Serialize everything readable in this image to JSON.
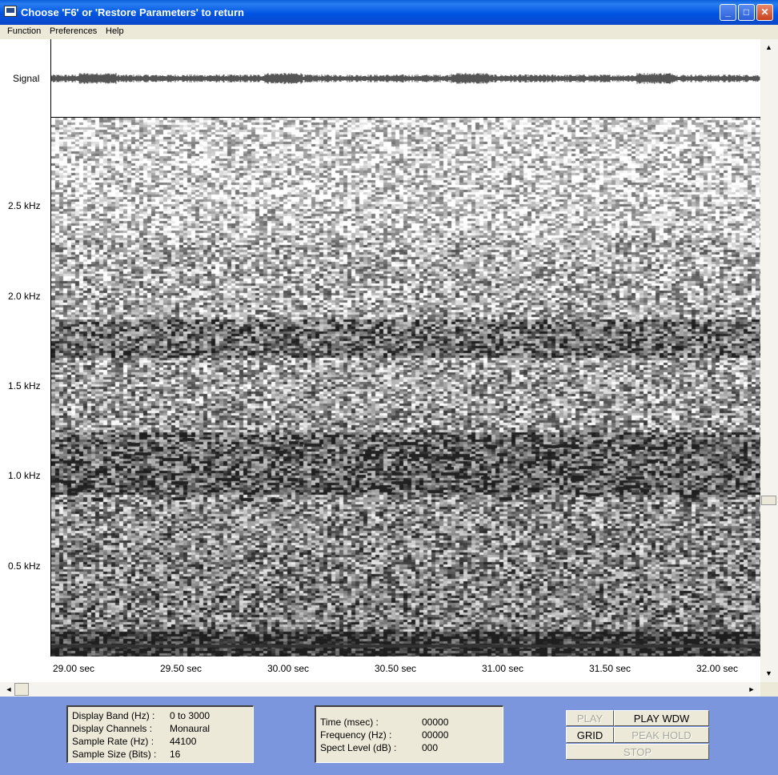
{
  "window": {
    "title": "Choose 'F6' or 'Restore Parameters' to return"
  },
  "title_buttons": {
    "minimize": "_",
    "maximize": "□",
    "close": "✕"
  },
  "menu": [
    "Function",
    "Preferences",
    "Help"
  ],
  "plot": {
    "signal_label": "Signal",
    "y_labels": [
      "2.5 kHz",
      "2.0 kHz",
      "1.5 kHz",
      "1.0 kHz",
      "0.5 kHz"
    ],
    "x_labels": [
      "29.00 sec",
      "29.50 sec",
      "30.00 sec",
      "30.50 sec",
      "31.00 sec",
      "31.50 sec",
      "32.00 sec"
    ]
  },
  "scroll": {
    "up": "▲",
    "down": "▼",
    "left": "◄",
    "right": "►"
  },
  "info_left": {
    "band_label": "Display Band (Hz) :",
    "band_value": "0 to 3000",
    "channels_label": "Display Channels :",
    "channels_value": "Monaural",
    "rate_label": "Sample Rate (Hz) :",
    "rate_value": "44100",
    "size_label": "Sample Size (Bits) :",
    "size_value": "16"
  },
  "info_mid": {
    "time_label": "Time (msec) :",
    "time_value": "00000",
    "freq_label": "Frequency (Hz) :",
    "freq_value": "00000",
    "level_label": "Spect Level (dB) :",
    "level_value": "000"
  },
  "controls": {
    "play": "PLAY",
    "play_wdw": "PLAY WDW",
    "grid": "GRID",
    "peak_hold": "PEAK HOLD",
    "stop": "STOP"
  }
}
